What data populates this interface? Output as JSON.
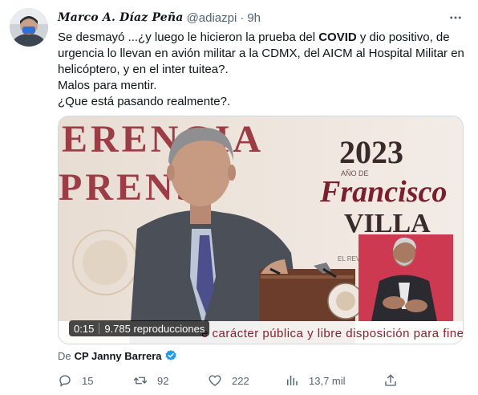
{
  "tweet": {
    "display_name": "Marco A. Díaz Peña",
    "handle": "@adiazpi",
    "dot": "·",
    "time": "9h",
    "text_parts": {
      "p1_a": "Se desmayó ...¿y luego le hicieron la prueba del ",
      "p1_bold": "COVID",
      "p1_b": " y dio positivo, de urgencia lo llevan en avión militar a la CDMX, del AICM al Hospital Militar en helicóptero, y en el inter tuitea?.",
      "p2": "Malos para mentir.",
      "p3": "¿Que está pasando realmente?."
    }
  },
  "media": {
    "backdrop_line1": "ERENGIA",
    "backdrop_line2": "PRENS",
    "banner_year": "2023",
    "banner_small": "AÑO DE",
    "banner_name1": "Francisco",
    "banner_name2": "VILLA",
    "banner_footer": "EL REVOL",
    "caption": "e carácter pública y libre disposición para fines m",
    "duration": "0:15",
    "views": "9.785 reproducciones"
  },
  "source": {
    "prefix": "De",
    "name": "CP Janny Barrera"
  },
  "actions": {
    "replies": "15",
    "retweets": "92",
    "likes": "222",
    "views": "13,7 mil"
  },
  "colors": {
    "text": "#0f1419",
    "secondary": "#536471",
    "verified": "#1d9bf0",
    "banner_red": "#7a1f2b"
  },
  "icons": {
    "more": "more-horizontal-icon",
    "reply": "reply-icon",
    "retweet": "retweet-icon",
    "like": "heart-icon",
    "views": "analytics-icon",
    "share": "share-icon",
    "verified": "verified-badge-icon"
  }
}
